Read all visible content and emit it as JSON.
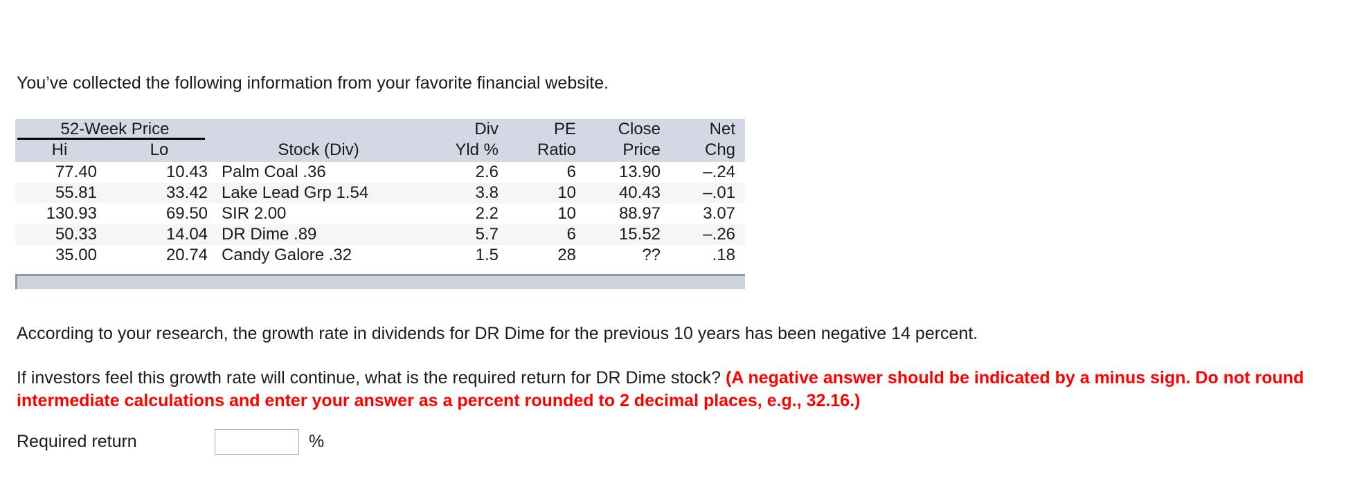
{
  "intro": {
    "text": "You’ve collected the following information from your favorite financial website."
  },
  "table": {
    "group_header": "52-Week Price",
    "headers_line1": {
      "hi": "",
      "lo": "",
      "stock": "",
      "div_yld": "Div",
      "pe": "PE",
      "close": "Close",
      "net": "Net"
    },
    "headers_line2": {
      "hi": "Hi",
      "lo": "Lo",
      "stock": "Stock (Div)",
      "div_yld": "Yld %",
      "pe": "Ratio",
      "close": "Price",
      "net": "Chg"
    },
    "rows": [
      {
        "hi": "77.40",
        "lo": "10.43",
        "stock": "Palm Coal .36",
        "div_yld": "2.6",
        "pe": "6",
        "close": "13.90",
        "net": "–.24"
      },
      {
        "hi": "55.81",
        "lo": "33.42",
        "stock": "Lake Lead Grp 1.54",
        "div_yld": "3.8",
        "pe": "10",
        "close": "40.43",
        "net": "–.01"
      },
      {
        "hi": "130.93",
        "lo": "69.50",
        "stock": "SIR 2.00",
        "div_yld": "2.2",
        "pe": "10",
        "close": "88.97",
        "net": "3.07"
      },
      {
        "hi": "50.33",
        "lo": "14.04",
        "stock": "DR Dime .89",
        "div_yld": "5.7",
        "pe": "6",
        "close": "15.52",
        "net": "–.26"
      },
      {
        "hi": "35.00",
        "lo": "20.74",
        "stock": "Candy Galore .32",
        "div_yld": "1.5",
        "pe": "28",
        "close": "??",
        "net": ".18"
      }
    ]
  },
  "paragraphs": {
    "research": "According to your research, the growth rate in dividends for DR Dime for the previous 10 years has been negative 14 percent.",
    "question_black": "If investors feel this growth rate will continue, what is the required return for DR Dime stock?",
    "question_red": "(A negative answer should be indicated by a minus sign. Do not round intermediate calculations and enter your answer as a percent rounded to 2 decimal places, e.g., 32.16.)"
  },
  "answer": {
    "label": "Required return",
    "value": "",
    "placeholder": "",
    "unit": "%"
  },
  "colors": {
    "header_fill": "#d3d8e4",
    "row_alt_fill": "#f5f5f5",
    "footer_bar_fill": "#ccd2de",
    "footer_bar_border": "#8f96a6",
    "emphasis_red": "#ff0000",
    "text": "#1a1a1a"
  }
}
